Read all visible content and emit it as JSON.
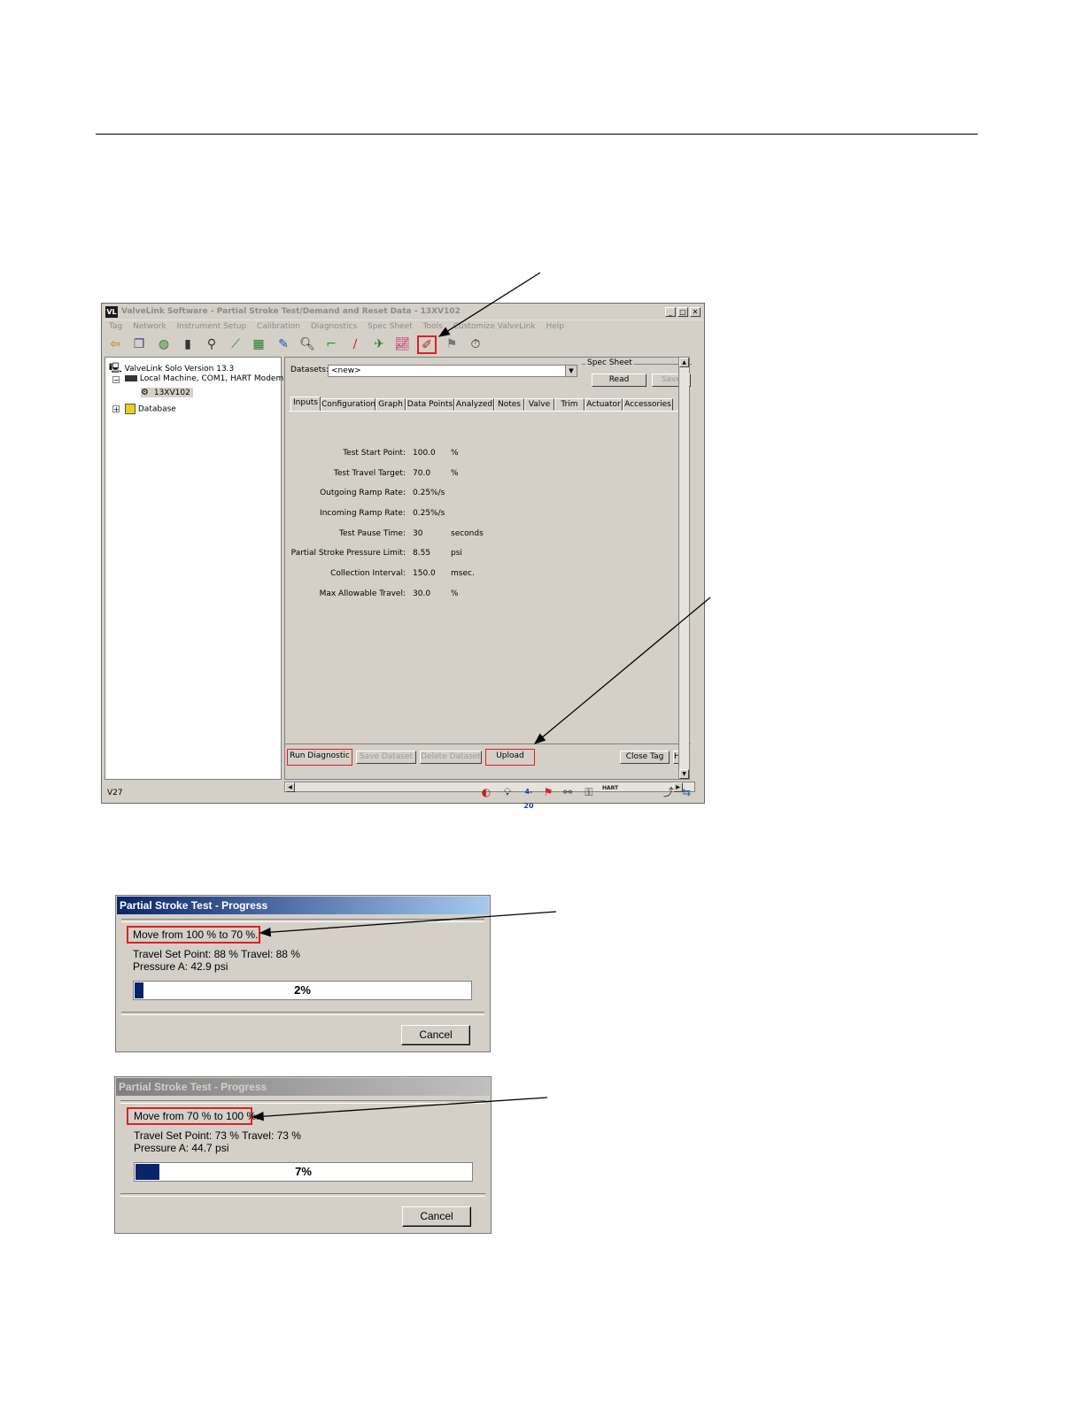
{
  "window": {
    "title": "ValveLink Software - Partial Stroke Test/Demand and Reset Data - 13XV102",
    "app_icon": "VL",
    "menu": [
      "Tag",
      "Network",
      "Instrument Setup",
      "Calibration",
      "Diagnostics",
      "Spec Sheet",
      "Tools",
      "Customize ValveLink",
      "Help"
    ],
    "tree": {
      "root": "ValveLink Solo Version 13.3",
      "connection": "Local Machine, COM1, HART Modem",
      "instrument": "13XV102",
      "database": "Database"
    },
    "datasets_label": "Datasets:",
    "datasets_value": "<new>",
    "spec_sheet": {
      "label": "Spec Sheet",
      "read": "Read",
      "save": "Save"
    },
    "tabs": [
      "Inputs",
      "Configuration",
      "Graph",
      "Data Points",
      "Analyzed",
      "Notes",
      "Valve",
      "Trim",
      "Actuator",
      "Accessories"
    ],
    "fields": [
      {
        "label": "Test Start Point:",
        "value": "100.0",
        "unit": "%"
      },
      {
        "label": "Test Travel Target:",
        "value": "70.0",
        "unit": "%"
      },
      {
        "label": "Outgoing Ramp Rate:",
        "value": "0.25%/s",
        "unit": ""
      },
      {
        "label": "Incoming Ramp Rate:",
        "value": "0.25%/s",
        "unit": ""
      },
      {
        "label": "Test Pause Time:",
        "value": "30",
        "unit": "seconds"
      },
      {
        "label": "Partial Stroke Pressure Limit:",
        "value": "8.55",
        "unit": "psi"
      },
      {
        "label": "Collection Interval:",
        "value": "150.0",
        "unit": "msec."
      },
      {
        "label": "Max Allowable Travel:",
        "value": "30.0",
        "unit": "%"
      }
    ],
    "buttons": {
      "run": "Run Diagnostic",
      "save_dataset": "Save Dataset",
      "delete_dataset": "Delete Dataset",
      "upload": "Upload",
      "close_tag": "Close Tag",
      "help": "H"
    },
    "status": "V27",
    "status_icon_text": {
      "loop": "4-20",
      "hart": "HART"
    }
  },
  "dialog1": {
    "title": "Partial Stroke Test - Progress",
    "move": "Move from 100 % to 70 %.",
    "setpoint": "Travel Set Point: 88 %   Travel: 88 %",
    "pressure": "Pressure A: 42.9 psi",
    "progress_text": "2%",
    "progress": 2,
    "cancel": "Cancel"
  },
  "dialog2": {
    "title": "Partial Stroke Test - Progress",
    "move": "Move from 70 % to 100 %.",
    "setpoint": "Travel Set Point: 73 %   Travel: 73 %",
    "pressure": "Pressure A: 44.7 psi",
    "progress_text": "7%",
    "progress": 7,
    "cancel": "Cancel"
  }
}
